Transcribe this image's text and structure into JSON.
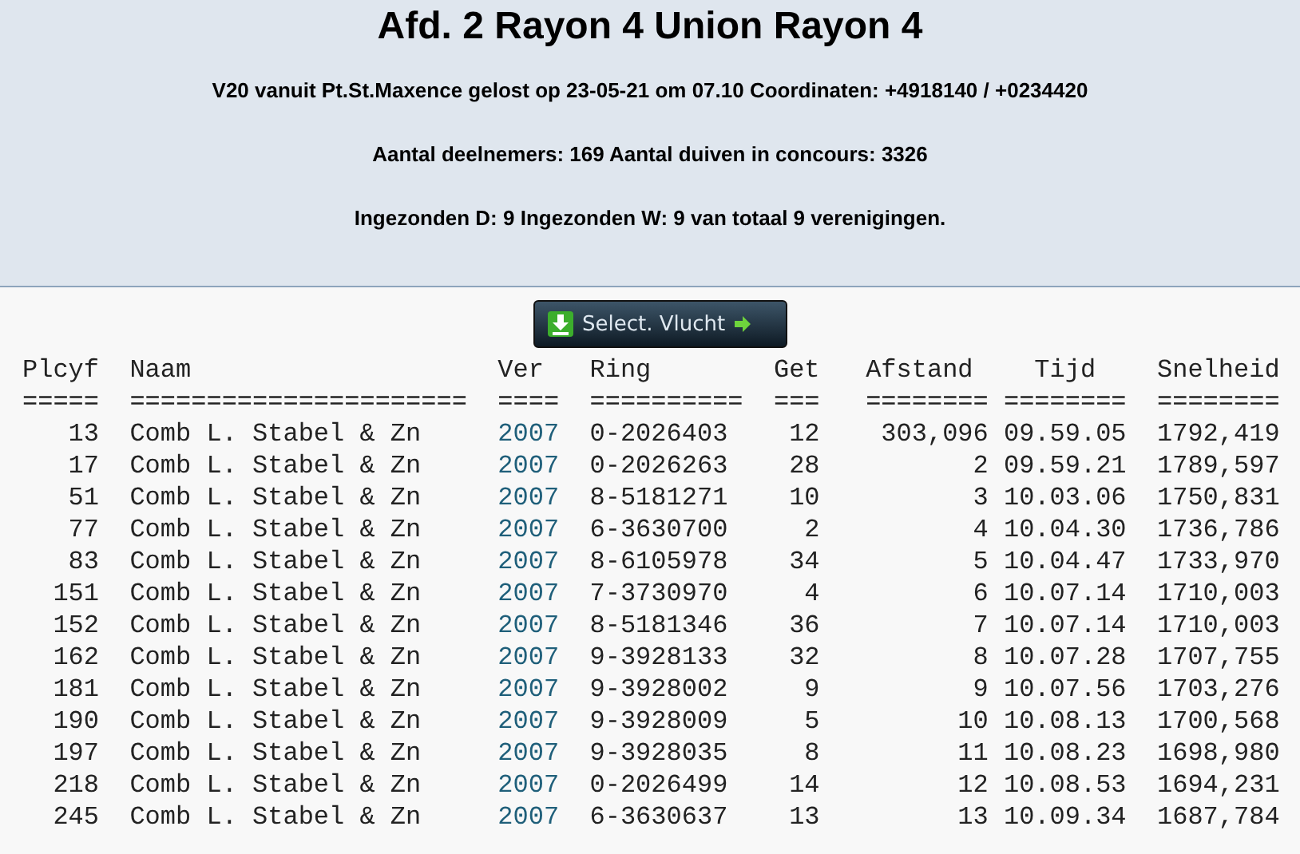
{
  "title": "Afd. 2 Rayon 4 Union Rayon 4",
  "info_lines": [
    "V20 vanuit Pt.St.Maxence gelost op 23-05-21 om 07.10 Coordinaten: +4918140 / +0234420",
    "Aantal deelnemers: 169 Aantal duiven in concours: 3326",
    "Ingezonden D: 9 Ingezonden W: 9 van totaal 9 verenigingen."
  ],
  "select_button": {
    "label": "Select. Vlucht"
  },
  "table": {
    "columns": [
      {
        "label": "Plcyf",
        "rule": "====="
      },
      {
        "label": "Naam",
        "rule": "======================"
      },
      {
        "label": "Ver",
        "rule": "===="
      },
      {
        "label": "Ring",
        "rule": "=========="
      },
      {
        "label": "Get",
        "rule": "==="
      },
      {
        "label": "Afstand",
        "rule": "========"
      },
      {
        "label": "Tijd",
        "rule": "========"
      },
      {
        "label": "Snelheid",
        "rule": "========"
      }
    ],
    "rows": [
      [
        "13",
        "Comb L. Stabel & Zn",
        "2007",
        "0-2026403",
        "12",
        "303,096",
        "09.59.05",
        "1792,419"
      ],
      [
        "17",
        "Comb L. Stabel & Zn",
        "2007",
        "0-2026263",
        "28",
        "2",
        "09.59.21",
        "1789,597"
      ],
      [
        "51",
        "Comb L. Stabel & Zn",
        "2007",
        "8-5181271",
        "10",
        "3",
        "10.03.06",
        "1750,831"
      ],
      [
        "77",
        "Comb L. Stabel & Zn",
        "2007",
        "6-3630700",
        "2",
        "4",
        "10.04.30",
        "1736,786"
      ],
      [
        "83",
        "Comb L. Stabel & Zn",
        "2007",
        "8-6105978",
        "34",
        "5",
        "10.04.47",
        "1733,970"
      ],
      [
        "151",
        "Comb L. Stabel & Zn",
        "2007",
        "7-3730970",
        "4",
        "6",
        "10.07.14",
        "1710,003"
      ],
      [
        "152",
        "Comb L. Stabel & Zn",
        "2007",
        "8-5181346",
        "36",
        "7",
        "10.07.14",
        "1710,003"
      ],
      [
        "162",
        "Comb L. Stabel & Zn",
        "2007",
        "9-3928133",
        "32",
        "8",
        "10.07.28",
        "1707,755"
      ],
      [
        "181",
        "Comb L. Stabel & Zn",
        "2007",
        "9-3928002",
        "9",
        "9",
        "10.07.56",
        "1703,276"
      ],
      [
        "190",
        "Comb L. Stabel & Zn",
        "2007",
        "9-3928009",
        "5",
        "10",
        "10.08.13",
        "1700,568"
      ],
      [
        "197",
        "Comb L. Stabel & Zn",
        "2007",
        "9-3928035",
        "8",
        "11",
        "10.08.23",
        "1698,980"
      ],
      [
        "218",
        "Comb L. Stabel & Zn",
        "2007",
        "0-2026499",
        "14",
        "12",
        "10.08.53",
        "1694,231"
      ],
      [
        "245",
        "Comb L. Stabel & Zn",
        "2007",
        "6-3630637",
        "13",
        "13",
        "10.09.34",
        "1687,784"
      ]
    ]
  }
}
